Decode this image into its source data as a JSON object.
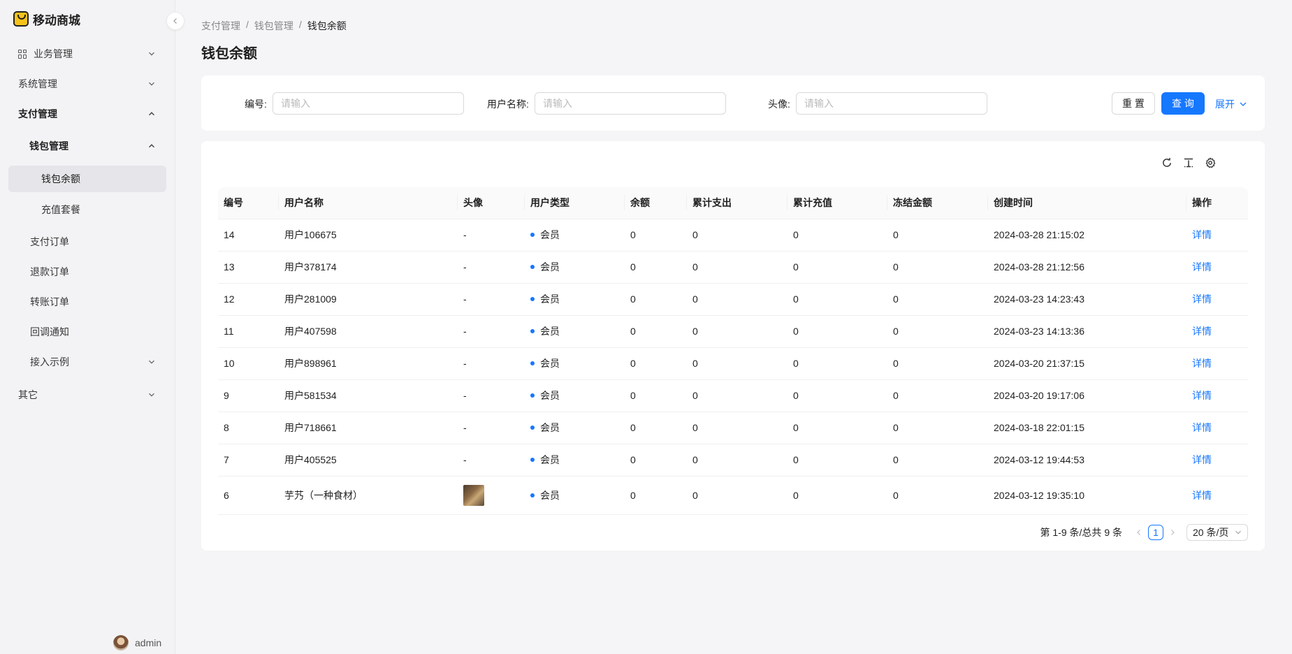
{
  "app": {
    "name": "移动商城"
  },
  "sidebar": {
    "items": [
      {
        "label": "业务管理",
        "expanded": false
      },
      {
        "label": "系统管理",
        "expanded": false
      },
      {
        "label": "支付管理",
        "expanded": true
      },
      {
        "label": "钱包管理",
        "expanded": true
      },
      {
        "label": "钱包余额",
        "active": true
      },
      {
        "label": "充值套餐"
      },
      {
        "label": "支付订单"
      },
      {
        "label": "退款订单"
      },
      {
        "label": "转账订单"
      },
      {
        "label": "回调通知"
      },
      {
        "label": "接入示例",
        "expanded": false
      },
      {
        "label": "其它",
        "expanded": false
      }
    ],
    "user": "admin"
  },
  "breadcrumb": [
    "支付管理",
    "钱包管理",
    "钱包余额"
  ],
  "page_title": "钱包余额",
  "search": {
    "fields": [
      {
        "label": "编号:",
        "placeholder": "请输入"
      },
      {
        "label": "用户名称:",
        "placeholder": "请输入"
      },
      {
        "label": "头像:",
        "placeholder": "请输入"
      }
    ],
    "reset_label": "重 置",
    "query_label": "查 询",
    "expand_label": "展开"
  },
  "toolbar": {
    "icons": [
      "reload-icon",
      "column-height-icon",
      "setting-icon"
    ]
  },
  "table": {
    "columns": [
      "编号",
      "用户名称",
      "头像",
      "用户类型",
      "余额",
      "累计支出",
      "累计充值",
      "冻结金额",
      "创建时间",
      "操作"
    ],
    "rows": [
      {
        "id": "14",
        "name": "用户106675",
        "avatar": "-",
        "type": "会员",
        "balance": "0",
        "expense": "0",
        "recharge": "0",
        "frozen": "0",
        "created": "2024-03-28 21:15:02",
        "action": "详情"
      },
      {
        "id": "13",
        "name": "用户378174",
        "avatar": "-",
        "type": "会员",
        "balance": "0",
        "expense": "0",
        "recharge": "0",
        "frozen": "0",
        "created": "2024-03-28 21:12:56",
        "action": "详情"
      },
      {
        "id": "12",
        "name": "用户281009",
        "avatar": "-",
        "type": "会员",
        "balance": "0",
        "expense": "0",
        "recharge": "0",
        "frozen": "0",
        "created": "2024-03-23 14:23:43",
        "action": "详情"
      },
      {
        "id": "11",
        "name": "用户407598",
        "avatar": "-",
        "type": "会员",
        "balance": "0",
        "expense": "0",
        "recharge": "0",
        "frozen": "0",
        "created": "2024-03-23 14:13:36",
        "action": "详情"
      },
      {
        "id": "10",
        "name": "用户898961",
        "avatar": "-",
        "type": "会员",
        "balance": "0",
        "expense": "0",
        "recharge": "0",
        "frozen": "0",
        "created": "2024-03-20 21:37:15",
        "action": "详情"
      },
      {
        "id": "9",
        "name": "用户581534",
        "avatar": "-",
        "type": "会员",
        "balance": "0",
        "expense": "0",
        "recharge": "0",
        "frozen": "0",
        "created": "2024-03-20 19:17:06",
        "action": "详情"
      },
      {
        "id": "8",
        "name": "用户718661",
        "avatar": "-",
        "type": "会员",
        "balance": "0",
        "expense": "0",
        "recharge": "0",
        "frozen": "0",
        "created": "2024-03-18 22:01:15",
        "action": "详情"
      },
      {
        "id": "7",
        "name": "用户405525",
        "avatar": "-",
        "type": "会员",
        "balance": "0",
        "expense": "0",
        "recharge": "0",
        "frozen": "0",
        "created": "2024-03-12 19:44:53",
        "action": "详情"
      },
      {
        "id": "6",
        "name": "芋艿（一种食材）",
        "avatar": "image",
        "type": "会员",
        "balance": "0",
        "expense": "0",
        "recharge": "0",
        "frozen": "0",
        "created": "2024-03-12 19:35:10",
        "action": "详情"
      }
    ]
  },
  "pagination": {
    "summary": "第 1-9 条/总共 9 条",
    "current": "1",
    "page_size": "20 条/页"
  },
  "colors": {
    "primary": "#1677ff",
    "logo": "#f7c31b"
  }
}
